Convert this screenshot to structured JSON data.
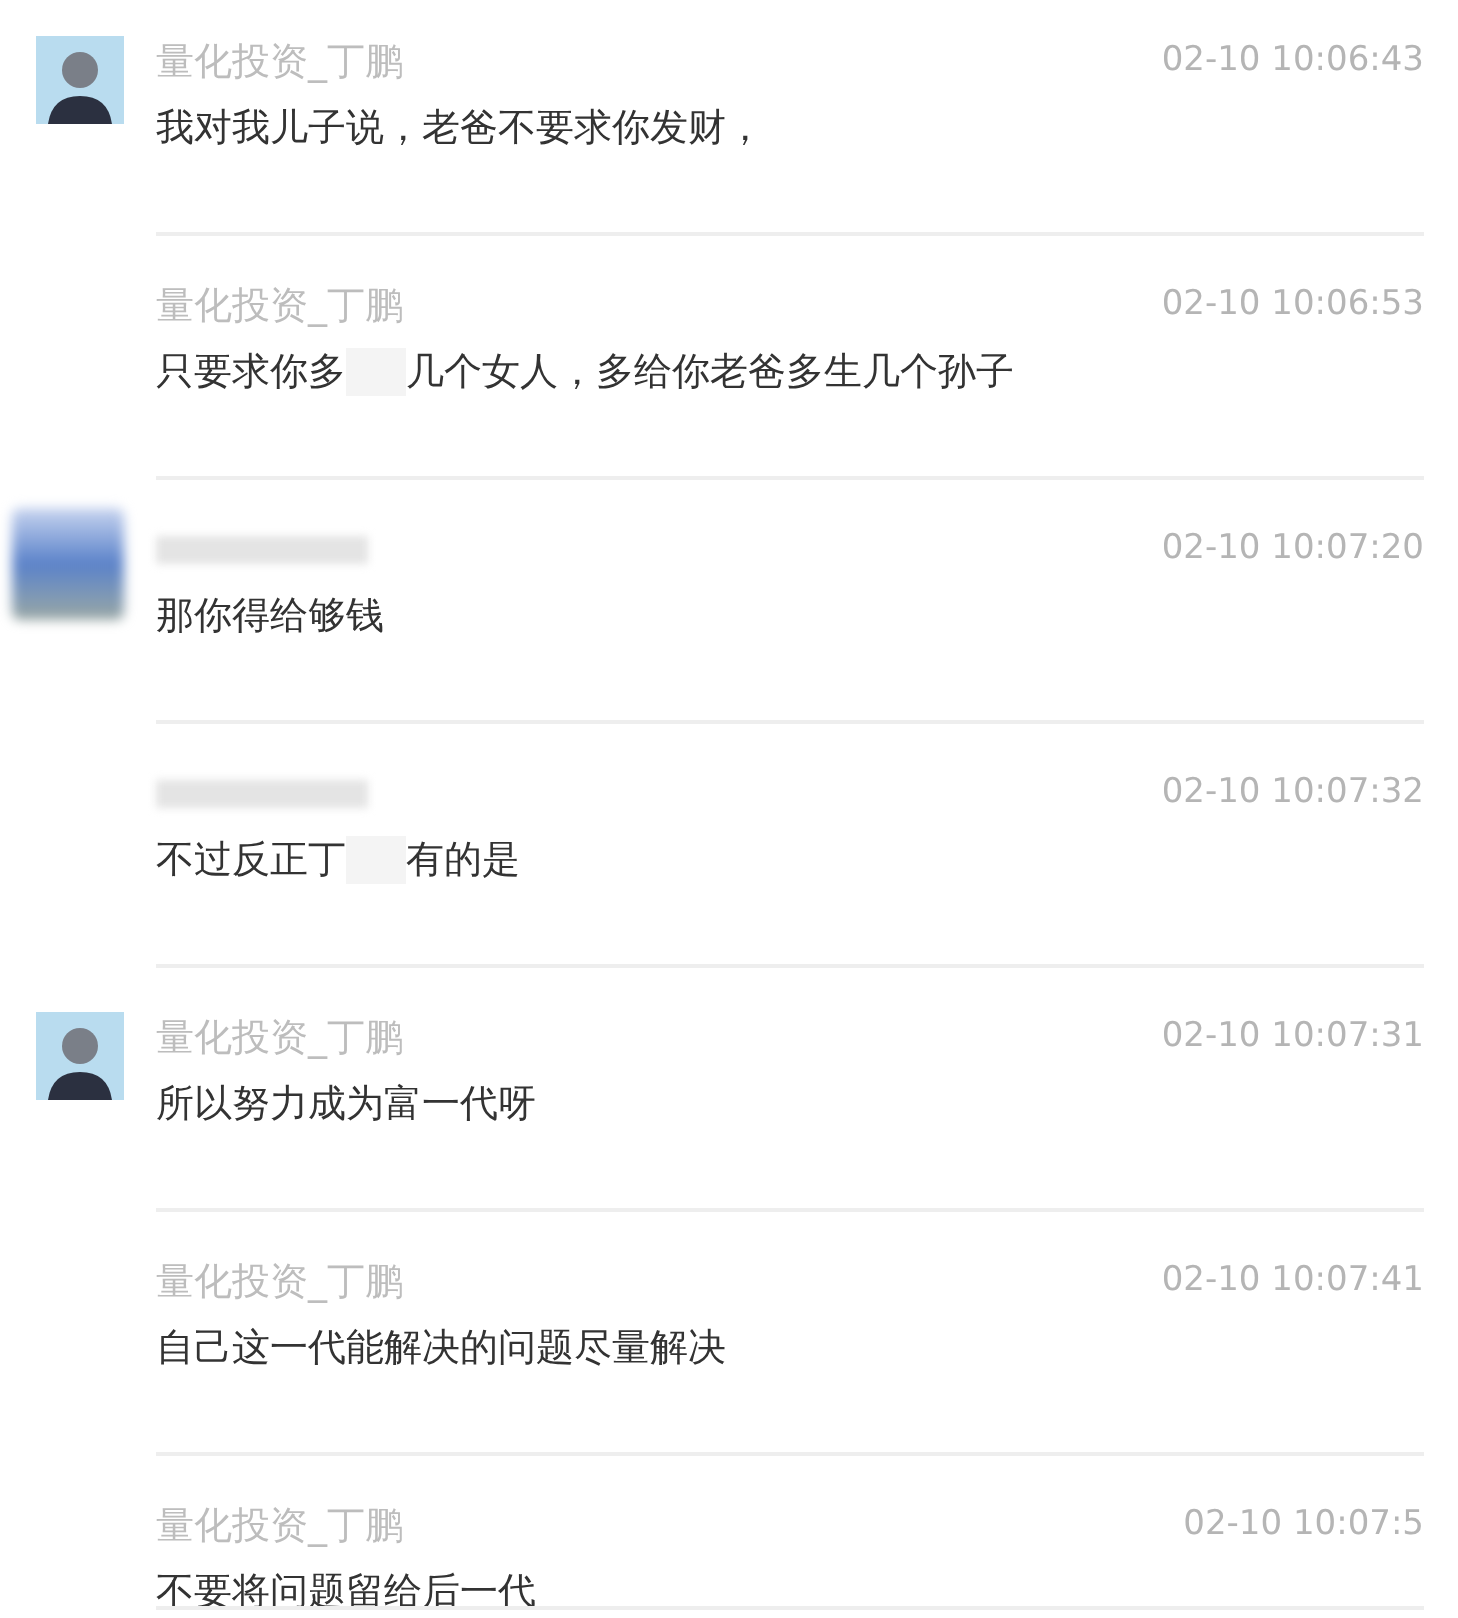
{
  "messages": [
    {
      "avatar": {
        "blurred": false
      },
      "name": "量化投资_丁鹏",
      "time": "02-10 10:06:43",
      "text_parts": [
        "我对我儿子说，老爸不要求你发财，"
      ]
    },
    {
      "name": "量化投资_丁鹏",
      "time": "02-10 10:06:53",
      "text_parts": [
        "只要求你多",
        "几个女人，多给你老爸多生几个孙子"
      ]
    },
    {
      "avatar": {
        "blurred": true
      },
      "name_hidden": true,
      "time": "02-10 10:07:20",
      "text_parts": [
        "那你得给够钱"
      ]
    },
    {
      "name_hidden": true,
      "time": "02-10 10:07:32",
      "text_parts": [
        "不过反正丁",
        "有的是"
      ]
    },
    {
      "avatar": {
        "blurred": false
      },
      "name": "量化投资_丁鹏",
      "time": "02-10 10:07:31",
      "text_parts": [
        "所以努力成为富一代呀"
      ]
    },
    {
      "name": "量化投资_丁鹏",
      "time": "02-10 10:07:41",
      "text_parts": [
        "自己这一代能解决的问题尽量解决"
      ]
    },
    {
      "name": "量化投资_丁鹏",
      "time": "02-10 10:07:5",
      "text_parts": [
        "不要将问题留给后一代"
      ]
    }
  ]
}
